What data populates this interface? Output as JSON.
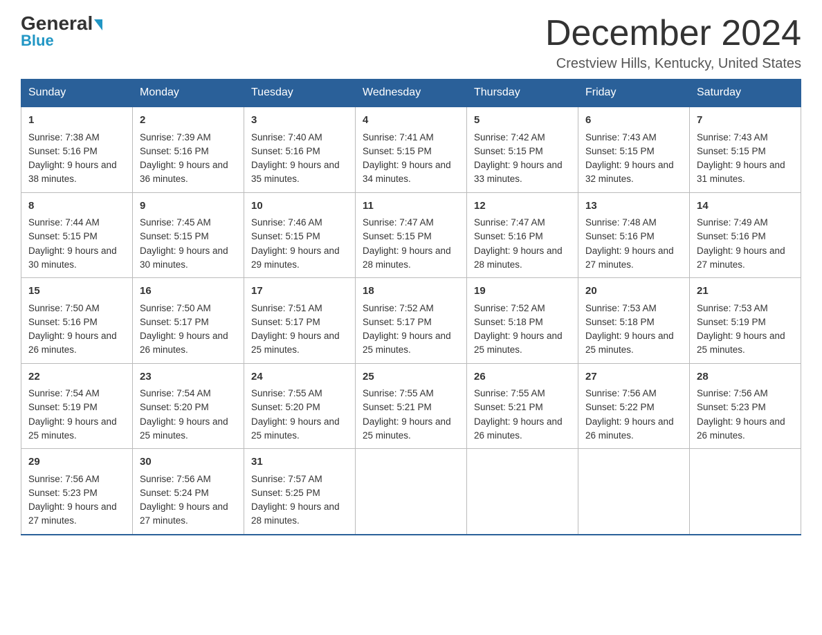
{
  "header": {
    "logo_main": "General",
    "logo_sub": "Blue",
    "month_title": "December 2024",
    "location": "Crestview Hills, Kentucky, United States"
  },
  "days_of_week": [
    "Sunday",
    "Monday",
    "Tuesday",
    "Wednesday",
    "Thursday",
    "Friday",
    "Saturday"
  ],
  "weeks": [
    [
      {
        "day": "1",
        "sunrise": "7:38 AM",
        "sunset": "5:16 PM",
        "daylight": "9 hours and 38 minutes."
      },
      {
        "day": "2",
        "sunrise": "7:39 AM",
        "sunset": "5:16 PM",
        "daylight": "9 hours and 36 minutes."
      },
      {
        "day": "3",
        "sunrise": "7:40 AM",
        "sunset": "5:16 PM",
        "daylight": "9 hours and 35 minutes."
      },
      {
        "day": "4",
        "sunrise": "7:41 AM",
        "sunset": "5:15 PM",
        "daylight": "9 hours and 34 minutes."
      },
      {
        "day": "5",
        "sunrise": "7:42 AM",
        "sunset": "5:15 PM",
        "daylight": "9 hours and 33 minutes."
      },
      {
        "day": "6",
        "sunrise": "7:43 AM",
        "sunset": "5:15 PM",
        "daylight": "9 hours and 32 minutes."
      },
      {
        "day": "7",
        "sunrise": "7:43 AM",
        "sunset": "5:15 PM",
        "daylight": "9 hours and 31 minutes."
      }
    ],
    [
      {
        "day": "8",
        "sunrise": "7:44 AM",
        "sunset": "5:15 PM",
        "daylight": "9 hours and 30 minutes."
      },
      {
        "day": "9",
        "sunrise": "7:45 AM",
        "sunset": "5:15 PM",
        "daylight": "9 hours and 30 minutes."
      },
      {
        "day": "10",
        "sunrise": "7:46 AM",
        "sunset": "5:15 PM",
        "daylight": "9 hours and 29 minutes."
      },
      {
        "day": "11",
        "sunrise": "7:47 AM",
        "sunset": "5:15 PM",
        "daylight": "9 hours and 28 minutes."
      },
      {
        "day": "12",
        "sunrise": "7:47 AM",
        "sunset": "5:16 PM",
        "daylight": "9 hours and 28 minutes."
      },
      {
        "day": "13",
        "sunrise": "7:48 AM",
        "sunset": "5:16 PM",
        "daylight": "9 hours and 27 minutes."
      },
      {
        "day": "14",
        "sunrise": "7:49 AM",
        "sunset": "5:16 PM",
        "daylight": "9 hours and 27 minutes."
      }
    ],
    [
      {
        "day": "15",
        "sunrise": "7:50 AM",
        "sunset": "5:16 PM",
        "daylight": "9 hours and 26 minutes."
      },
      {
        "day": "16",
        "sunrise": "7:50 AM",
        "sunset": "5:17 PM",
        "daylight": "9 hours and 26 minutes."
      },
      {
        "day": "17",
        "sunrise": "7:51 AM",
        "sunset": "5:17 PM",
        "daylight": "9 hours and 25 minutes."
      },
      {
        "day": "18",
        "sunrise": "7:52 AM",
        "sunset": "5:17 PM",
        "daylight": "9 hours and 25 minutes."
      },
      {
        "day": "19",
        "sunrise": "7:52 AM",
        "sunset": "5:18 PM",
        "daylight": "9 hours and 25 minutes."
      },
      {
        "day": "20",
        "sunrise": "7:53 AM",
        "sunset": "5:18 PM",
        "daylight": "9 hours and 25 minutes."
      },
      {
        "day": "21",
        "sunrise": "7:53 AM",
        "sunset": "5:19 PM",
        "daylight": "9 hours and 25 minutes."
      }
    ],
    [
      {
        "day": "22",
        "sunrise": "7:54 AM",
        "sunset": "5:19 PM",
        "daylight": "9 hours and 25 minutes."
      },
      {
        "day": "23",
        "sunrise": "7:54 AM",
        "sunset": "5:20 PM",
        "daylight": "9 hours and 25 minutes."
      },
      {
        "day": "24",
        "sunrise": "7:55 AM",
        "sunset": "5:20 PM",
        "daylight": "9 hours and 25 minutes."
      },
      {
        "day": "25",
        "sunrise": "7:55 AM",
        "sunset": "5:21 PM",
        "daylight": "9 hours and 25 minutes."
      },
      {
        "day": "26",
        "sunrise": "7:55 AM",
        "sunset": "5:21 PM",
        "daylight": "9 hours and 26 minutes."
      },
      {
        "day": "27",
        "sunrise": "7:56 AM",
        "sunset": "5:22 PM",
        "daylight": "9 hours and 26 minutes."
      },
      {
        "day": "28",
        "sunrise": "7:56 AM",
        "sunset": "5:23 PM",
        "daylight": "9 hours and 26 minutes."
      }
    ],
    [
      {
        "day": "29",
        "sunrise": "7:56 AM",
        "sunset": "5:23 PM",
        "daylight": "9 hours and 27 minutes."
      },
      {
        "day": "30",
        "sunrise": "7:56 AM",
        "sunset": "5:24 PM",
        "daylight": "9 hours and 27 minutes."
      },
      {
        "day": "31",
        "sunrise": "7:57 AM",
        "sunset": "5:25 PM",
        "daylight": "9 hours and 28 minutes."
      },
      null,
      null,
      null,
      null
    ]
  ],
  "labels": {
    "sunrise": "Sunrise:",
    "sunset": "Sunset:",
    "daylight": "Daylight:"
  },
  "colors": {
    "header_bg": "#2a6099",
    "accent": "#2196c4"
  }
}
